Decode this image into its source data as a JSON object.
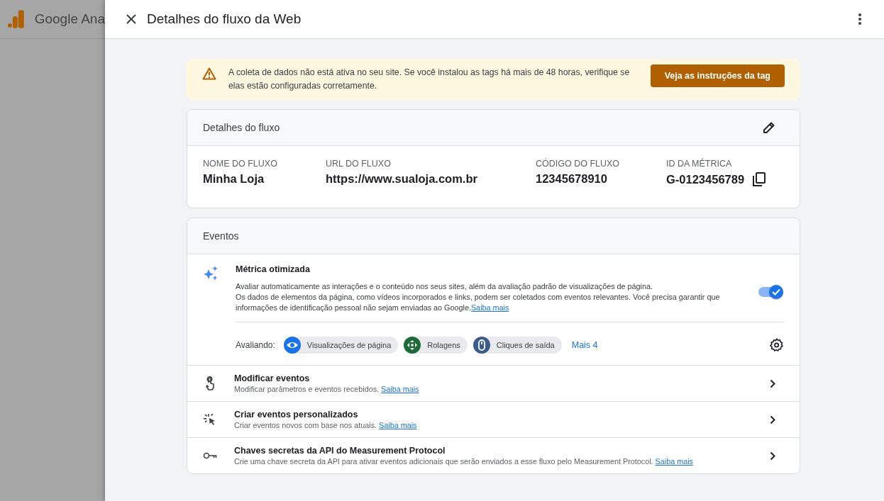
{
  "backdrop": {
    "app_name": "Google Ana"
  },
  "header": {
    "title": "Detalhes do fluxo da Web"
  },
  "alert": {
    "message": "A coleta de dados não está ativa no seu site. Se você instalou as tags há mais de 48 horas, verifique se elas estão configuradas corretamente.",
    "button": "Veja as instruções da tag"
  },
  "stream_details": {
    "title": "Detalhes do fluxo",
    "fields": [
      {
        "label": "NOME DO FLUXO",
        "value": "Minha Loja",
        "copy": false
      },
      {
        "label": "URL DO FLUXO",
        "value": "https://www.sualoja.com.br",
        "copy": false
      },
      {
        "label": "CÓDIGO DO FLUXO",
        "value": "12345678910",
        "copy": false
      },
      {
        "label": "ID DA MÉTRICA",
        "value": "G-0123456789",
        "copy": true
      }
    ]
  },
  "events": {
    "title": "Eventos",
    "enhanced": {
      "title": "Métrica otimizada",
      "description": "Avaliar automaticamente as interações e o conteúdo nos seus sites, além da avaliação padrão de visualizações de página.",
      "note": "Os dados de elementos da página, como vídeos incorporados e links, podem ser coletados com eventos relevantes. Você precisa garantir que informações de identificação pessoal não sejam enviadas ao Google.",
      "link": "Saiba mais",
      "on": true,
      "measuring_label": "Avaliando:",
      "chips": [
        {
          "kind": "eye",
          "label": "Visualizações de página",
          "color": "#1a73e8"
        },
        {
          "kind": "scroll",
          "label": "Rolagens",
          "color": "#1e6b3a"
        },
        {
          "kind": "mouse",
          "label": "Cliques de saída",
          "color": "#3d5a8c"
        }
      ],
      "more": "Mais 4"
    },
    "rows": [
      {
        "kind": "touch",
        "title": "Modificar eventos",
        "description": "Modificar parâmetros e eventos recebidos.",
        "link": "Saiba mais"
      },
      {
        "kind": "click",
        "title": "Criar eventos personalizados",
        "description": "Criar eventos novos com base nos atuais.",
        "link": "Saiba mais"
      },
      {
        "kind": "key",
        "title": "Chaves secretas da API do Measurement Protocol",
        "description": "Crie uma chave secreta da API para ativar eventos adicionais que serão enviados a esse fluxo pelo Measurement Protocol.",
        "link": "Saiba mais"
      }
    ]
  }
}
